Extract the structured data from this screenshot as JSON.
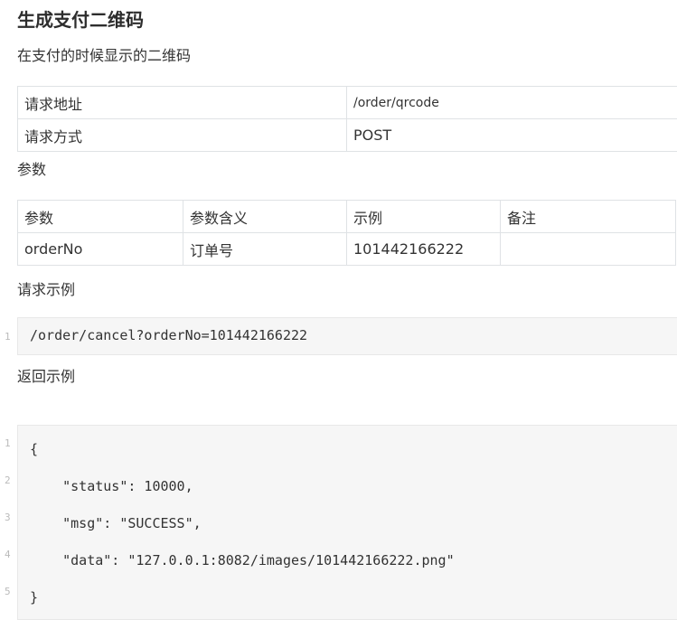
{
  "title": "生成支付二维码",
  "description": "在支付的时候显示的二维码",
  "request_table": {
    "rows": [
      {
        "label": "请求地址",
        "value": "/order/qrcode"
      },
      {
        "label": "请求方式",
        "value": "POST"
      }
    ]
  },
  "params_label": "参数",
  "params_table": {
    "headers": [
      "参数",
      "参数含义",
      "示例",
      "备注"
    ],
    "rows": [
      [
        "orderNo",
        "订单号",
        "101442166222",
        ""
      ]
    ]
  },
  "request_example_label": "请求示例",
  "request_example": {
    "lines": [
      {
        "no": "1",
        "text": "/order/cancel?orderNo=101442166222"
      }
    ]
  },
  "response_example_label": "返回示例",
  "response_example": {
    "lines": [
      {
        "no": "1",
        "text": "{"
      },
      {
        "no": "2",
        "text": "    \"status\": 10000,"
      },
      {
        "no": "3",
        "text": "    \"msg\": \"SUCCESS\","
      },
      {
        "no": "4",
        "text": "    \"data\": \"127.0.0.1:8082/images/101442166222.png\""
      },
      {
        "no": "5",
        "text": "}"
      }
    ]
  }
}
